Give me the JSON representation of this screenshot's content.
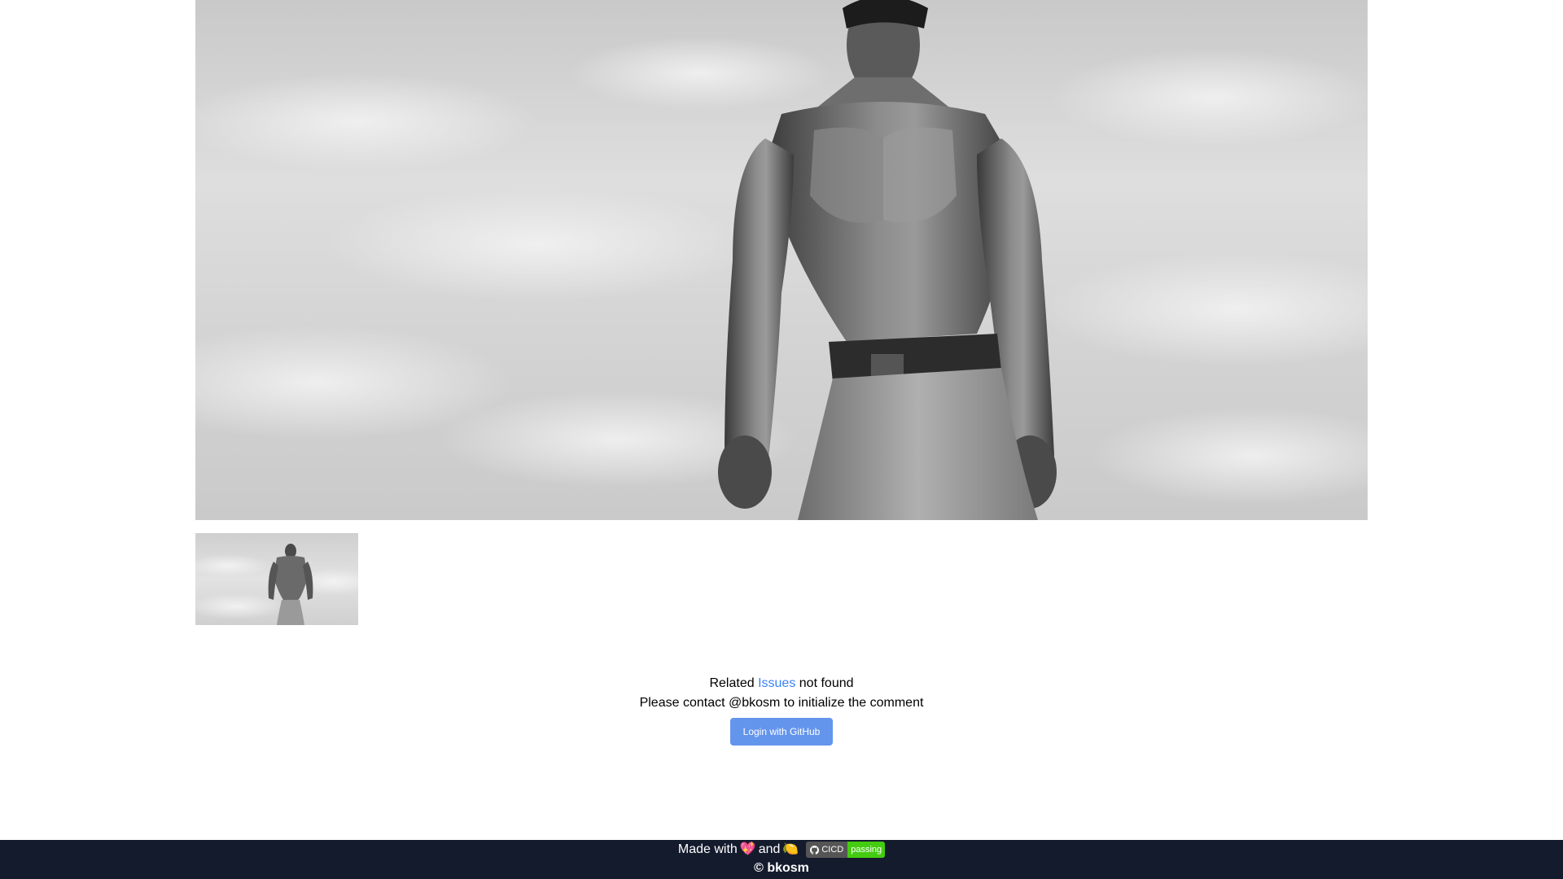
{
  "gallery": {
    "main_image_alt": "bodybuilder-photo",
    "thumbnail_alt": "bodybuilder-thumbnail"
  },
  "comments": {
    "related_prefix": "Related",
    "issues_link": "Issues",
    "related_suffix": "not found",
    "contact_message": "Please contact @bkosm to initialize the comment",
    "login_button": "Login with GitHub",
    "link_color": "#3b82f6",
    "button_color": "#6495ed"
  },
  "footer": {
    "made_with": "Made with",
    "and": "and",
    "heart_icon": "sparkling-heart-emoji",
    "lemon_icon": "lemon-emoji",
    "badge": {
      "label": "CICD",
      "status": "passing",
      "icon": "github-icon"
    },
    "copyright": "© bkosm",
    "background": "#141b2d"
  }
}
